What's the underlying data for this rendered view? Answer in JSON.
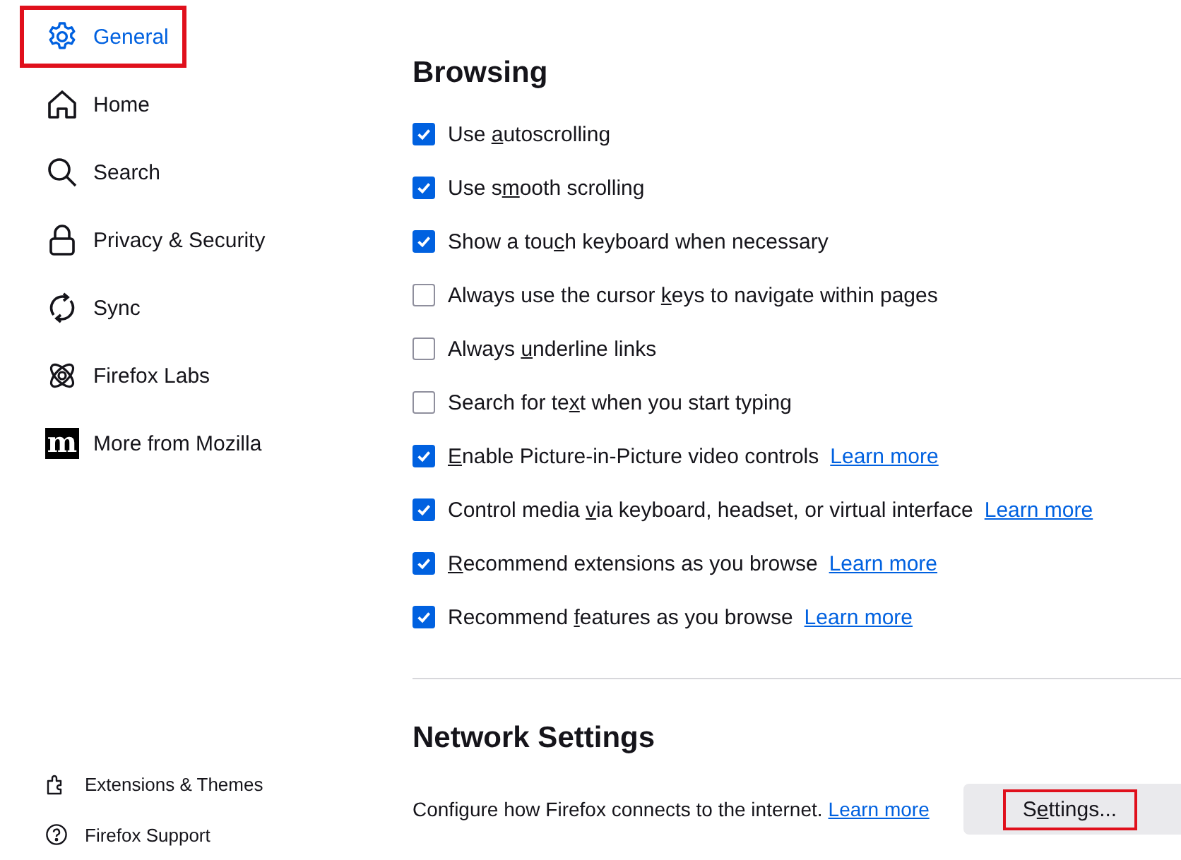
{
  "sidebar": {
    "items": [
      {
        "label": "General",
        "selected": true,
        "highlighted": true
      },
      {
        "label": "Home",
        "selected": false,
        "highlighted": false
      },
      {
        "label": "Search",
        "selected": false,
        "highlighted": false
      },
      {
        "label": "Privacy & Security",
        "selected": false,
        "highlighted": false
      },
      {
        "label": "Sync",
        "selected": false,
        "highlighted": false
      },
      {
        "label": "Firefox Labs",
        "selected": false,
        "highlighted": false
      },
      {
        "label": "More from Mozilla",
        "selected": false,
        "highlighted": false,
        "logo_text": "m"
      }
    ],
    "footer_links": [
      {
        "label": "Extensions & Themes"
      },
      {
        "label": "Firefox Support"
      }
    ]
  },
  "browsing": {
    "title": "Browsing",
    "options": [
      {
        "label": {
          "before": "Use ",
          "key": "a",
          "after": "utoscrolling"
        },
        "checked": true
      },
      {
        "label": {
          "before": "Use s",
          "key": "m",
          "after": "ooth scrolling"
        },
        "checked": true
      },
      {
        "label": {
          "before": "Show a tou",
          "key": "c",
          "after": "h keyboard when necessary"
        },
        "checked": true
      },
      {
        "label": {
          "before": "Always use the cursor ",
          "key": "k",
          "after": "eys to navigate within pages"
        },
        "checked": false
      },
      {
        "label": {
          "before": "Always ",
          "key": "u",
          "after": "nderline links"
        },
        "checked": false
      },
      {
        "label": {
          "before": "Search for te",
          "key": "x",
          "after": "t when you start typing"
        },
        "checked": false
      },
      {
        "label": {
          "key": "E",
          "after": "nable Picture-in-Picture video controls"
        },
        "checked": true,
        "link": "Learn more"
      },
      {
        "label": {
          "before": "Control media ",
          "key": "v",
          "after": "ia keyboard, headset, or virtual interface"
        },
        "checked": true,
        "link": "Learn more"
      },
      {
        "label": {
          "key": "R",
          "after": "ecommend extensions as you browse"
        },
        "checked": true,
        "link": "Learn more"
      },
      {
        "label": {
          "before": "Recommend ",
          "key": "f",
          "after": "eatures as you browse"
        },
        "checked": true,
        "link": "Learn more"
      }
    ]
  },
  "network": {
    "title": "Network Settings",
    "description": "Configure how Firefox connects to the internet.",
    "link": "Learn more",
    "button": {
      "label": {
        "before": "S",
        "key": "e",
        "after": "ttings..."
      },
      "highlighted": true
    }
  }
}
